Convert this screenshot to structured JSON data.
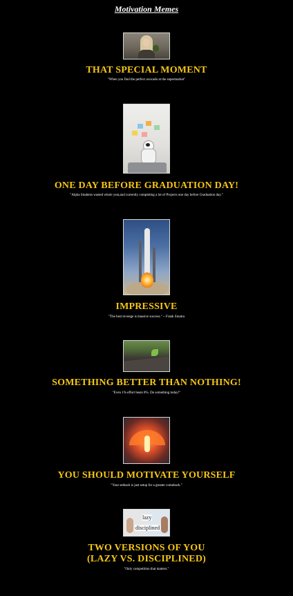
{
  "page": {
    "title": "Motivation Memes"
  },
  "colors": {
    "background": "#000000",
    "heading": "#f5c518",
    "text": "#ffffff"
  },
  "memes": [
    {
      "image_icon": "girl-with-avocado-image",
      "heading": "THAT SPECIAL MOMENT",
      "quote": "\"When you find the perfect avocado at the supermarket\""
    },
    {
      "image_icon": "robot-at-laptop-image",
      "heading": "ONE DAY BEFORE GRADUATION DAY!",
      "quote": "\"Alpha Students wasted whole year,and currently completing a lot of Projects one day before Graduation day.\""
    },
    {
      "image_icon": "rocket-launch-image",
      "heading": "IMPRESSIVE",
      "quote": "\"The best revenge is massive success.\" ~ Frank Sinatra"
    },
    {
      "image_icon": "plant-sprout-image",
      "heading": "SOMETHING BETTER THAN NOTHING!",
      "quote": "\"Even 1% effort beats 0%. Do something today!\""
    },
    {
      "image_icon": "phoenix-image",
      "heading": "YOU SHOULD MOTIVATE YOURSELF",
      "quote": "\"Your setback is just setup for a greater comeback.\""
    },
    {
      "image_icon": "lazy-vs-disciplined-image",
      "image_labels": {
        "left": "lazy",
        "right": "disciplined"
      },
      "heading_line1": "TWO VERSIONS OF YOU",
      "heading_line2": "(LAZY VS. DISCIPLINED)",
      "quote": "\"Only competition that matters.\""
    }
  ]
}
